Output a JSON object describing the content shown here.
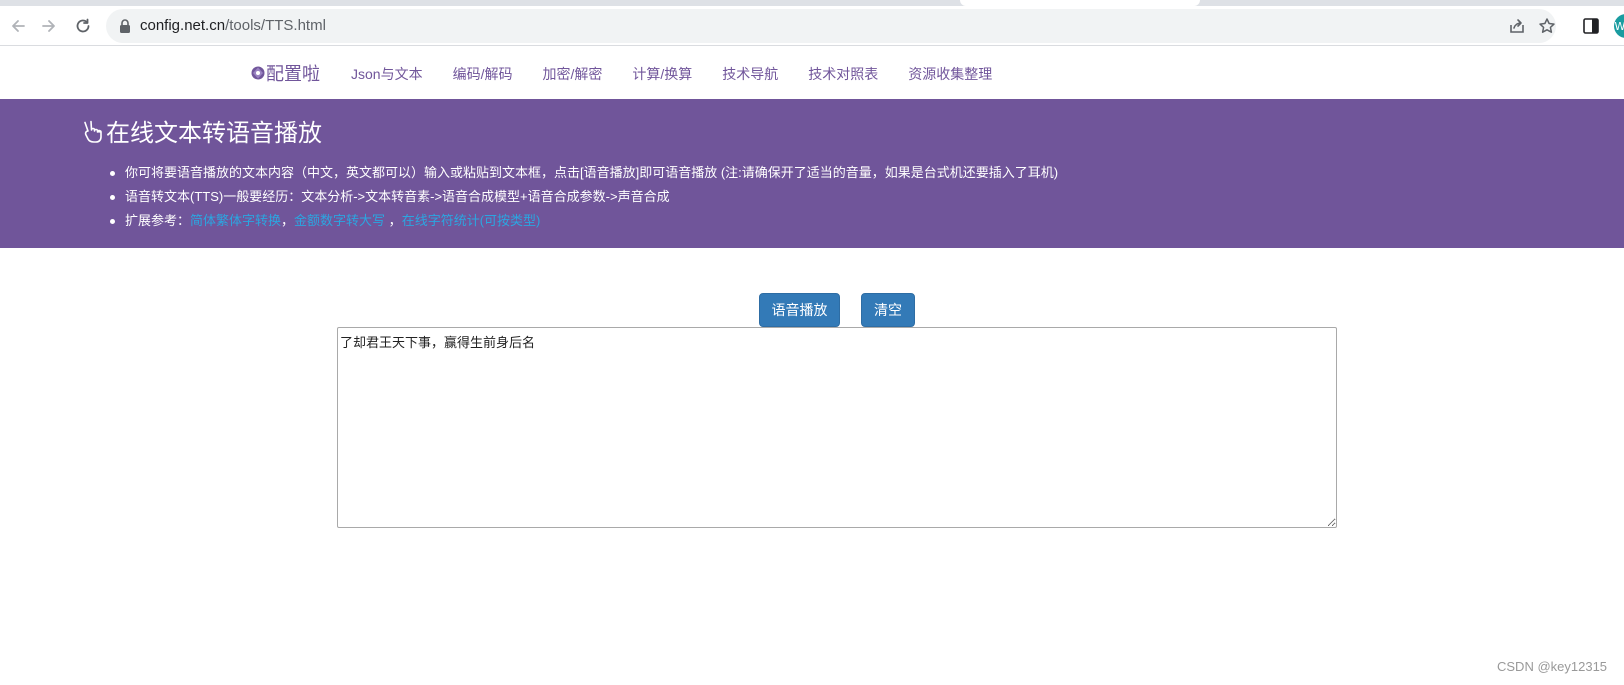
{
  "browser": {
    "url_host": "config.net.cn",
    "url_path": "/tools/TTS.html",
    "profile_initial": "W"
  },
  "navbar": {
    "brand": "配置啦",
    "links": [
      "Json与文本",
      "编码/解码",
      "加密/解密",
      "计算/换算",
      "技术导航",
      "技术对照表",
      "资源收集整理"
    ]
  },
  "hero": {
    "title": "在线文本转语音播放",
    "items": [
      "你可将要语音播放的文本内容（中文，英文都可以）输入或粘贴到文本框，点击[语音播放]即可语音播放 (注:请确保开了适当的音量，如果是台式机还要插入了耳机)",
      "语音转文本(TTS)一般要经历：文本分析->文本转音素->语音合成模型+语音合成参数->声音合成"
    ],
    "ref_label": "扩展参考：",
    "ref_links": [
      "简体繁体字转换",
      "金额数字转大写",
      "在线字符统计(可按类型)"
    ],
    "ref_sep1": "，",
    "ref_sep2": " ，"
  },
  "actions": {
    "play_label": "语音播放",
    "clear_label": "清空"
  },
  "textarea": {
    "value": "了却君王天下事，赢得生前身后名"
  },
  "watermark": "CSDN @key12315",
  "colors": {
    "brand_purple": "#70559a",
    "link_blue": "#2ba6e1",
    "button_blue": "#337ab7"
  }
}
